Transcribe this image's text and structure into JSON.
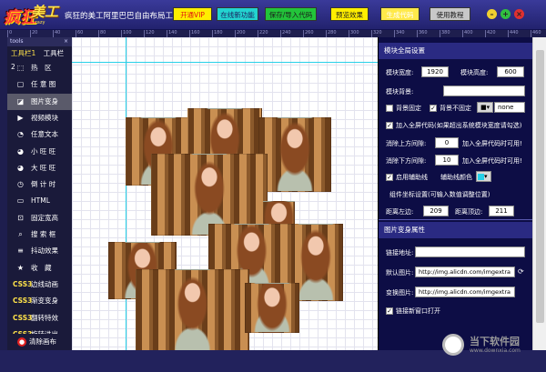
{
  "app": {
    "logo_main": "疯狂",
    "logo_accent": "美工",
    "logo_sub": "crazy",
    "title": "疯狂的美工阿里巴巴自由布局工具"
  },
  "toolbar": {
    "buttons": [
      {
        "label": "开通VIP",
        "bg": "#ffee00",
        "fg": "#e01010"
      },
      {
        "label": "在线新功能",
        "bg": "#22d4d0",
        "fg": "#1a1a5a"
      },
      {
        "label": "保存/导入代码",
        "bg": "#22c43a",
        "fg": "#1a1a1a"
      },
      {
        "label": "预览效果",
        "bg": "#ffee00",
        "fg": "#1a1a1a"
      },
      {
        "label": "生成代码",
        "bg": "#ffe94a",
        "fg": "#ffffff"
      },
      {
        "label": "使用教程",
        "bg": "#c8c8c8",
        "fg": "#1a1a1a"
      }
    ],
    "window_controls": [
      {
        "name": "minimize",
        "glyph": "–",
        "bg": "#f0d030"
      },
      {
        "name": "maximize",
        "glyph": "+",
        "bg": "#30c040"
      },
      {
        "name": "close",
        "glyph": "×",
        "bg": "#e03030"
      }
    ]
  },
  "ruler": {
    "ticks": [
      "0",
      "20",
      "40",
      "60",
      "80",
      "100",
      "120",
      "140",
      "160",
      "180",
      "200",
      "220",
      "240",
      "260",
      "280",
      "300",
      "320",
      "340",
      "360",
      "380",
      "400",
      "420",
      "440",
      "460"
    ]
  },
  "sidebar": {
    "header": "tools",
    "close": "×",
    "tabs": [
      "工具栏1",
      "工具栏2"
    ],
    "items": [
      {
        "label": "热　区",
        "icon": "dashed-rect-icon",
        "glyph": "⬚",
        "css3": false
      },
      {
        "label": "任 意 图",
        "icon": "image-frame-icon",
        "glyph": "▢",
        "css3": false
      },
      {
        "label": "图片变身",
        "icon": "image-swap-icon",
        "glyph": "◪",
        "css3": false,
        "selected": true
      },
      {
        "label": "视频模块",
        "icon": "video-icon",
        "glyph": "▶",
        "css3": false
      },
      {
        "label": "任意文本",
        "icon": "text-bubble-icon",
        "glyph": "◔",
        "css3": false
      },
      {
        "label": "小 旺 旺",
        "icon": "wangwang-small-icon",
        "glyph": "◕",
        "css3": false
      },
      {
        "label": "大 旺 旺",
        "icon": "wangwang-large-icon",
        "glyph": "◕",
        "css3": false
      },
      {
        "label": "倒 计 时",
        "icon": "clock-icon",
        "glyph": "◷",
        "css3": false
      },
      {
        "label": "HTML",
        "icon": "html-icon",
        "glyph": "▭",
        "css3": false
      },
      {
        "label": "固定宽高",
        "icon": "fixed-size-icon",
        "glyph": "⊡",
        "css3": false
      },
      {
        "label": "搜 索 框",
        "icon": "search-icon",
        "glyph": "⌕",
        "css3": false
      },
      {
        "label": "抖动效果",
        "icon": "shake-icon",
        "glyph": "≡",
        "css3": false
      },
      {
        "label": "收　藏",
        "icon": "star-icon",
        "glyph": "★",
        "css3": false
      },
      {
        "label": "边线动画",
        "icon": "css3-badge-icon",
        "glyph": "CSS3",
        "css3": true
      },
      {
        "label": "渐变变身",
        "icon": "css3-badge-icon",
        "glyph": "CSS3",
        "css3": true
      },
      {
        "label": "翻转特效",
        "icon": "css3-badge-icon",
        "glyph": "CSS3",
        "css3": true
      },
      {
        "label": "旋转进出",
        "icon": "css3-badge-icon",
        "glyph": "CSS3",
        "css3": true
      }
    ],
    "clear_label": "清除画布"
  },
  "module_settings": {
    "title": "模块全局设置",
    "width_label": "模块宽度:",
    "width_value": "1920",
    "height_label": "模块高度:",
    "height_value": "600",
    "bg_label": "模块背景:",
    "bg_fixed_label": "背景固定",
    "bg_unfixed_label": "背景不固定",
    "bg_repeat_value": "none",
    "fullscreen_label": "加入全屏代码(如果超出系统模块宽度请勾选)",
    "top_gap_label": "消除上方间隙:",
    "top_gap_value": "0",
    "top_gap_hint": "加入全屏代码时可用!",
    "bottom_gap_label": "消除下方间隙:",
    "bottom_gap_value": "10",
    "bottom_gap_hint": "加入全屏代码时可用!",
    "guides_label": "启用辅助线",
    "guide_color_label": "辅助线颜色",
    "coords_label": "组件坐标设置(可输入数值调整位置)",
    "left_label": "距离左边:",
    "left_value": "209",
    "top_label": "距离顶边:",
    "top_value": "211"
  },
  "image_props": {
    "title": "图片变身属性",
    "link_label": "链接地址:",
    "link_value": "",
    "default_label": "默认图片:",
    "default_value": "http://img.alicdn.com/imgextra",
    "swap_label": "变换图片:",
    "swap_value": "http://img.alicdn.com/imgextra",
    "new_window_label": "链接新窗口打开"
  },
  "watermark": {
    "name": "当下软件园",
    "url": "www.downxia.com"
  }
}
